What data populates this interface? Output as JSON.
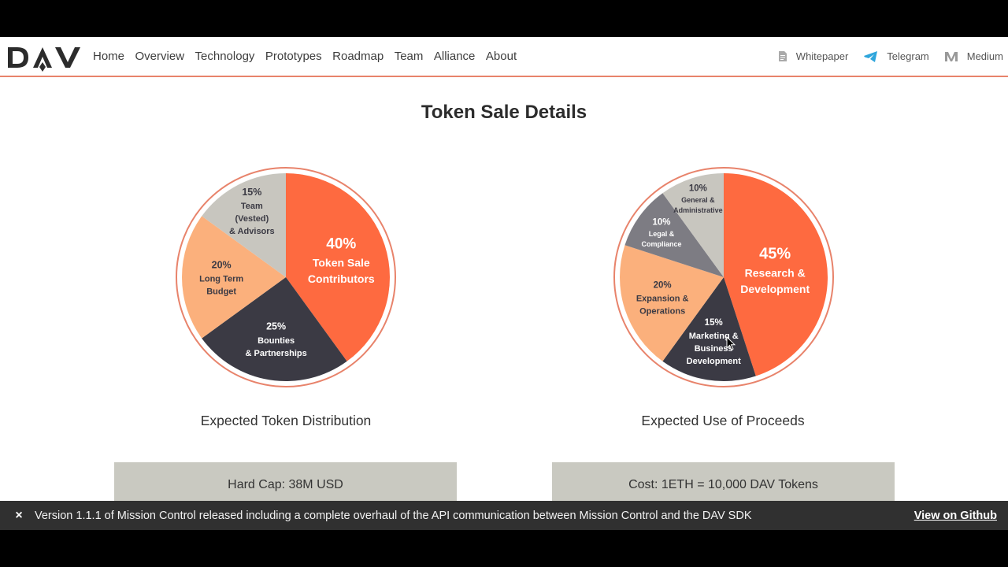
{
  "nav": {
    "logo_text": "DAV",
    "links": [
      "Home",
      "Overview",
      "Technology",
      "Prototypes",
      "Roadmap",
      "Team",
      "Alliance",
      "About"
    ],
    "external": [
      {
        "label": "Whitepaper",
        "icon": "document-icon"
      },
      {
        "label": "Telegram",
        "icon": "telegram-icon"
      },
      {
        "label": "Medium",
        "icon": "medium-icon"
      }
    ]
  },
  "section": {
    "title": "Token Sale Details"
  },
  "colors": {
    "orange": "#fe6a40",
    "dark": "#3b3a44",
    "peach": "#fbb07c",
    "grey": "#c8c6bf",
    "midgrey": "#7d7c83",
    "ring": "#e8836b"
  },
  "chart_data": [
    {
      "type": "pie",
      "title": "Expected Token Distribution",
      "slices": [
        {
          "pct": "40%",
          "value": 40,
          "label": [
            "Token Sale",
            "Contributors"
          ],
          "color": "#fe6a40"
        },
        {
          "pct": "25%",
          "value": 25,
          "label": [
            "Bounties",
            "& Partnerships"
          ],
          "color": "#3b3a44"
        },
        {
          "pct": "20%",
          "value": 20,
          "label": [
            "Long Term",
            "Budget"
          ],
          "color": "#fbb07c"
        },
        {
          "pct": "15%",
          "value": 15,
          "label": [
            "Team",
            "(Vested)",
            "& Advisors"
          ],
          "color": "#c8c6bf"
        }
      ]
    },
    {
      "type": "pie",
      "title": "Expected Use of Proceeds",
      "slices": [
        {
          "pct": "45%",
          "value": 45,
          "label": [
            "Research &",
            "Development"
          ],
          "color": "#fe6a40"
        },
        {
          "pct": "15%",
          "value": 15,
          "label": [
            "Marketing &",
            "Business",
            "Development"
          ],
          "color": "#3b3a44"
        },
        {
          "pct": "20%",
          "value": 20,
          "label": [
            "Expansion &",
            "Operations"
          ],
          "color": "#fbb07c"
        },
        {
          "pct": "10%",
          "value": 10,
          "label": [
            "Legal &",
            "Compliance"
          ],
          "color": "#7d7c83"
        },
        {
          "pct": "10%",
          "value": 10,
          "label": [
            "General &",
            "Administrative"
          ],
          "color": "#c8c6bf"
        }
      ]
    }
  ],
  "boxes": {
    "left": "Hard Cap: 38M USD",
    "right": "Cost: 1ETH = 10,000 DAV Tokens"
  },
  "notice": {
    "close": "×",
    "text": "Version 1.1.1 of Mission Control released including a complete overhaul of the API communication between Mission Control and the DAV SDK",
    "link": "View on Github"
  }
}
